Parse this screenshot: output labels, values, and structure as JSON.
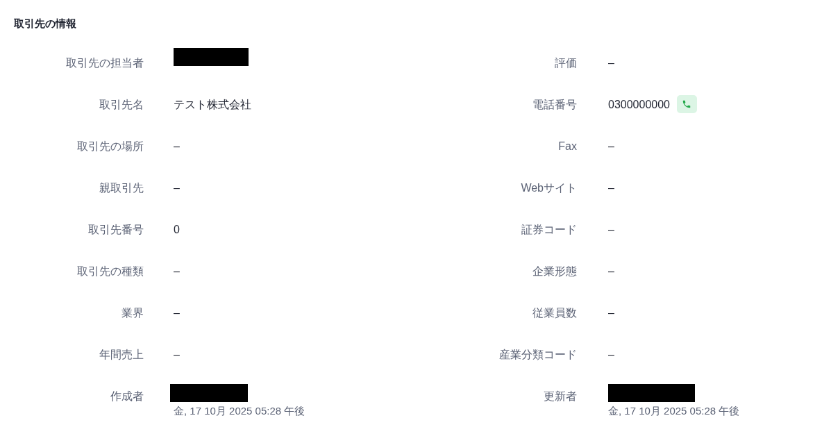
{
  "section_title": "取引先の情報",
  "left_fields": [
    {
      "label": "取引先の担当者",
      "kind": "redacted"
    },
    {
      "label": "取引先名",
      "kind": "text",
      "value": "テスト株式会社"
    },
    {
      "label": "取引先の場所",
      "kind": "text",
      "value": "–"
    },
    {
      "label": "親取引先",
      "kind": "text",
      "value": "–"
    },
    {
      "label": "取引先番号",
      "kind": "text",
      "value": "0"
    },
    {
      "label": "取引先の種類",
      "kind": "text",
      "value": "–"
    },
    {
      "label": "業界",
      "kind": "text",
      "value": "–"
    },
    {
      "label": "年間売上",
      "kind": "text",
      "value": "–"
    },
    {
      "label": "作成者",
      "kind": "audit",
      "timestamp": "金, 17 10月 2025 05:28 午後"
    }
  ],
  "right_fields": [
    {
      "label": "評価",
      "kind": "text",
      "value": "–"
    },
    {
      "label": "電話番号",
      "kind": "phone",
      "value": "0300000000"
    },
    {
      "label": "Fax",
      "kind": "text",
      "value": "–"
    },
    {
      "label": "Webサイト",
      "kind": "text",
      "value": "–"
    },
    {
      "label": "証券コード",
      "kind": "text",
      "value": "–"
    },
    {
      "label": "企業形態",
      "kind": "text",
      "value": "–"
    },
    {
      "label": "従業員数",
      "kind": "text",
      "value": "–"
    },
    {
      "label": "産業分類コード",
      "kind": "text",
      "value": "–"
    },
    {
      "label": "更新者",
      "kind": "audit",
      "timestamp": "金, 17 10月 2025 05:28 午後"
    }
  ]
}
